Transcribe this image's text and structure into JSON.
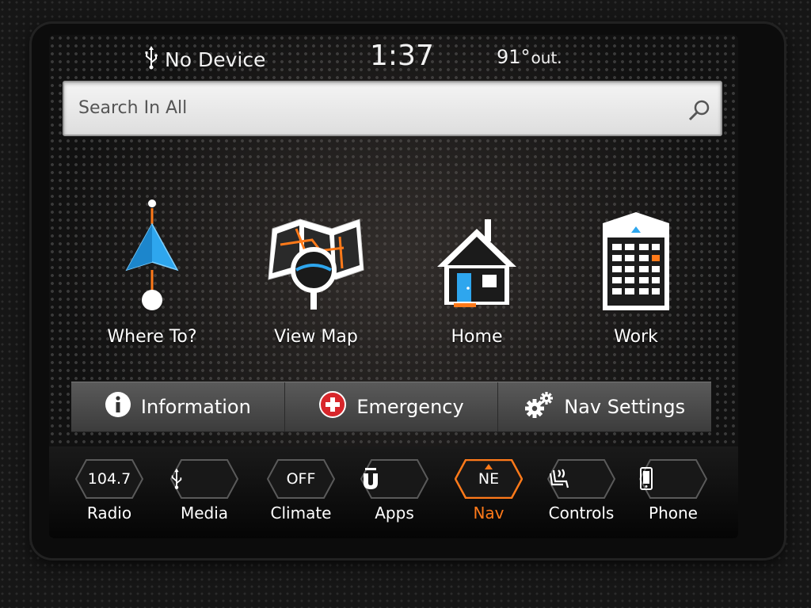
{
  "status": {
    "usb_label": "No Device",
    "time": "1:37",
    "temp_value": "91°",
    "temp_suffix": "out."
  },
  "search": {
    "placeholder": "Search In All"
  },
  "tiles": [
    {
      "label": "Where To?",
      "icon": "navigation-arrow-icon"
    },
    {
      "label": "View Map",
      "icon": "map-magnifier-icon"
    },
    {
      "label": "Home",
      "icon": "house-icon"
    },
    {
      "label": "Work",
      "icon": "office-building-icon"
    }
  ],
  "actions": [
    {
      "label": "Information",
      "icon": "info-icon"
    },
    {
      "label": "Emergency",
      "icon": "emergency-cross-icon"
    },
    {
      "label": "Nav Settings",
      "icon": "gear-icon"
    }
  ],
  "dock": [
    {
      "name": "Radio",
      "value": "104.7"
    },
    {
      "name": "Media",
      "value": "",
      "icon": "usb-icon"
    },
    {
      "name": "Climate",
      "value": "OFF"
    },
    {
      "name": "Apps",
      "value": "",
      "icon": "apps-icon"
    },
    {
      "name": "Nav",
      "value": "NE",
      "active": true
    },
    {
      "name": "Controls",
      "value": "",
      "icon": "seat-controls-icon"
    },
    {
      "name": "Phone",
      "value": "",
      "icon": "phone-icon"
    }
  ],
  "colors": {
    "accent": "#ff7a1a",
    "nav_blue": "#2ea6ee"
  }
}
